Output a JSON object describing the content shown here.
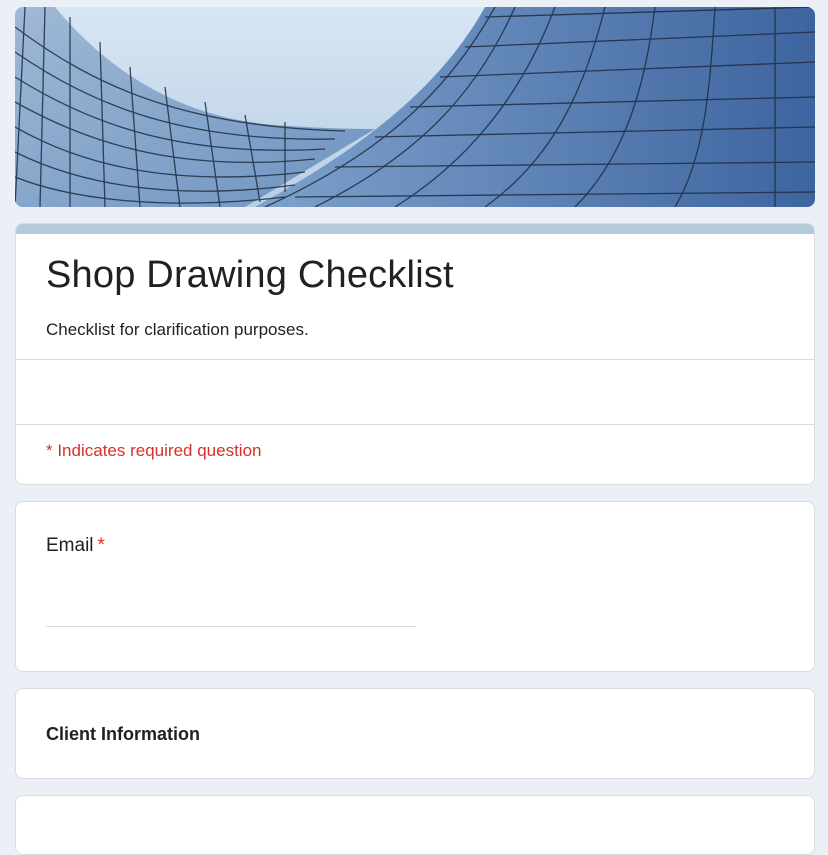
{
  "form": {
    "title": "Shop Drawing Checklist",
    "description": "Checklist for clarification purposes.",
    "required_note": "* Indicates required question",
    "accent_color": "#b3cad9",
    "required_color": "#d93025"
  },
  "banner": {
    "image": "glass-building-facade"
  },
  "email_question": {
    "label": "Email",
    "required_marker": "*",
    "value": ""
  },
  "section": {
    "title": "Client Information"
  }
}
